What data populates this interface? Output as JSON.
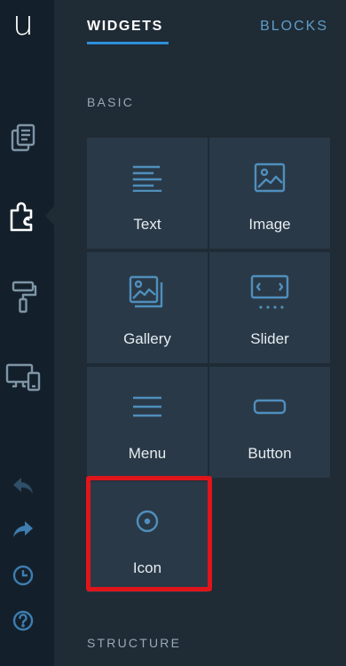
{
  "app": {
    "logo_letter": "u"
  },
  "tabs": [
    {
      "label": "WIDGETS",
      "active": true
    },
    {
      "label": "BLOCKS",
      "active": false
    }
  ],
  "sections": {
    "basic": "BASIC",
    "structure": "STRUCTURE"
  },
  "widgets": [
    {
      "label": "Text",
      "icon": "text-align-icon"
    },
    {
      "label": "Image",
      "icon": "image-icon"
    },
    {
      "label": "Gallery",
      "icon": "gallery-icon"
    },
    {
      "label": "Slider",
      "icon": "slider-icon"
    },
    {
      "label": "Menu",
      "icon": "menu-icon"
    },
    {
      "label": "Button",
      "icon": "button-icon"
    },
    {
      "label": "Icon",
      "icon": "target-icon",
      "highlighted": true
    }
  ],
  "colors": {
    "accent": "#2e8fd8",
    "icon": "#4f8fbd",
    "highlight": "#e0151b",
    "tile_bg": "#2a3947"
  }
}
